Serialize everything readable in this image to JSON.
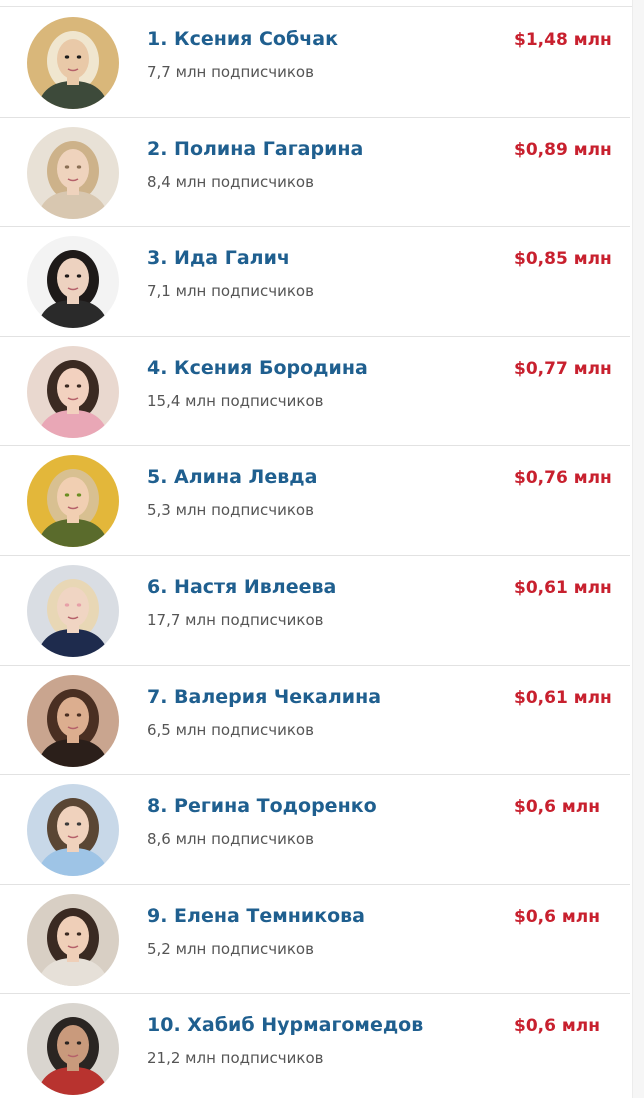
{
  "colors": {
    "name": "#1f5f8f",
    "earnings": "#c8202e",
    "subscribers": "#555555",
    "divider": "#e2e2e2"
  },
  "ranking": [
    {
      "name": "1. Ксения Собчак",
      "subscribers": "7,7 млн подписчиков",
      "earnings": "$1,48 млн",
      "avatar_bg": "#d9b77a",
      "hair": "#f0e6cf",
      "skin": "#e9c9a8",
      "cloth": "#3d4a3a",
      "accent": "#1b1b1b"
    },
    {
      "name": "2. Полина Гагарина",
      "subscribers": "8,4 млн подписчиков",
      "earnings": "$0,89 млн",
      "avatar_bg": "#e8e1d6",
      "hair": "#cdb28a",
      "skin": "#efd3bd",
      "cloth": "#d8c7b0",
      "accent": "#8a6f55"
    },
    {
      "name": "3. Ида Галич",
      "subscribers": "7,1 млн подписчиков",
      "earnings": "$0,85 млн",
      "avatar_bg": "#f3f3f3",
      "hair": "#1e1a19",
      "skin": "#edd2c0",
      "cloth": "#2a2a2a",
      "accent": "#1e1a19"
    },
    {
      "name": "4. Ксения Бородина",
      "subscribers": "15,4 млн подписчиков",
      "earnings": "$0,77 млн",
      "avatar_bg": "#e9d8cf",
      "hair": "#3b2a22",
      "skin": "#f2d1bf",
      "cloth": "#e9a7b6",
      "accent": "#3b2a22"
    },
    {
      "name": "5. Алина Левда",
      "subscribers": "5,3 млн подписчиков",
      "earnings": "$0,76 млн",
      "avatar_bg": "#e3b73a",
      "hair": "#d8c091",
      "skin": "#f1cfb2",
      "cloth": "#5a6b2c",
      "accent": "#6b8e23"
    },
    {
      "name": "6. Настя Ивлеева",
      "subscribers": "17,7 млн подписчиков",
      "earnings": "$0,61 млн",
      "avatar_bg": "#d9dde3",
      "hair": "#e8d7b5",
      "skin": "#f0d5c3",
      "cloth": "#1e2b4d",
      "accent": "#e7a0a8"
    },
    {
      "name": "7. Валерия Чекалина",
      "subscribers": "6,5 млн подписчиков",
      "earnings": "$0,61 млн",
      "avatar_bg": "#c9a58f",
      "hair": "#4a2f22",
      "skin": "#dcae8f",
      "cloth": "#2b1f1a",
      "accent": "#4a2f22"
    },
    {
      "name": "8. Регина Тодоренко",
      "subscribers": "8,6 млн подписчиков",
      "earnings": "$0,6 млн",
      "avatar_bg": "#c8d8e8",
      "hair": "#5a4634",
      "skin": "#f0d2bd",
      "cloth": "#9ec4e6",
      "accent": "#3b3b3b"
    },
    {
      "name": "9. Елена Темникова",
      "subscribers": "5,2 млн подписчиков",
      "earnings": "$0,6 млн",
      "avatar_bg": "#d8cfc4",
      "hair": "#3a2a22",
      "skin": "#efcfb8",
      "cloth": "#e6e0d8",
      "accent": "#3a2a22"
    },
    {
      "name": "10. Хабиб Нурмагомедов",
      "subscribers": "21,2 млн подписчиков",
      "earnings": "$0,6 млн",
      "avatar_bg": "#d9d5cf",
      "hair": "#2a2522",
      "skin": "#c99a7c",
      "cloth": "#b8332f",
      "accent": "#2a2522"
    }
  ]
}
